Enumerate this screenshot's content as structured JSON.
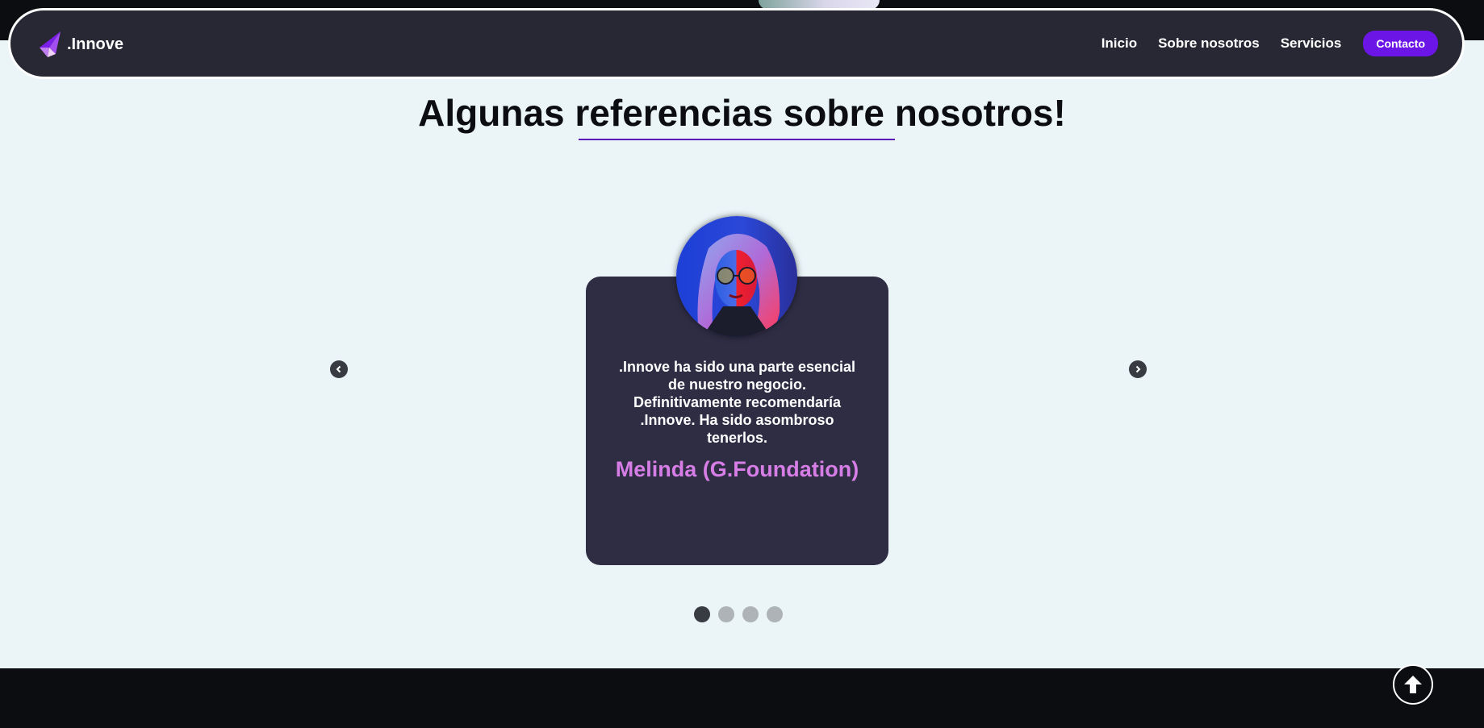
{
  "brand": {
    "name": ".Innove",
    "logo_icon": "paper-plane-logo-icon"
  },
  "nav": {
    "links": [
      "Inicio",
      "Sobre nosotros",
      "Servicios"
    ],
    "cta": "Contacto"
  },
  "section": {
    "title": "Algunas referencias sobre nosotros!"
  },
  "testimonial": {
    "quote": ".Innove ha sido una parte esencial de nuestro negocio. Definitivamente recomendaría .Innove. Ha sido asombroso tenerlos.",
    "author": "Melinda (G.Foundation)"
  },
  "carousel": {
    "slide_count": 4,
    "active_index": 0
  },
  "icons": {
    "prev": "chevron-left-icon",
    "next": "chevron-right-icon",
    "scroll_top": "arrow-up-icon"
  },
  "colors": {
    "background": "#ebf5f8",
    "navbar": "#272833",
    "accent": "#6b16e6",
    "card": "#2f2d44",
    "author": "#d67de6",
    "footer": "#0b0d10"
  }
}
